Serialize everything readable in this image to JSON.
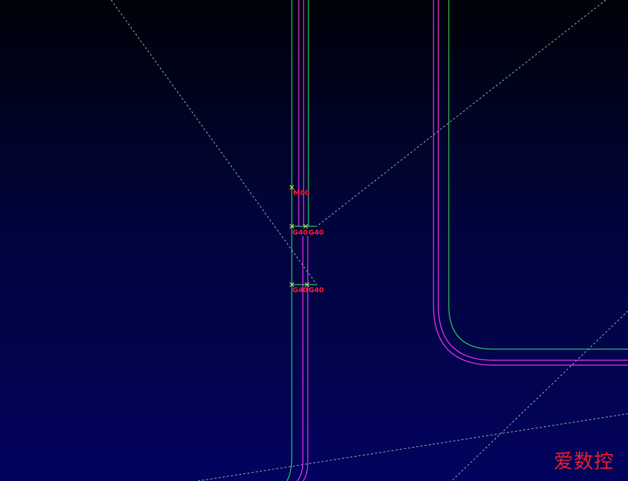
{
  "canvas": {
    "background_top": "#000208",
    "background_bottom": "#02035e"
  },
  "colors": {
    "part_contour": "#33ff66",
    "tool_path": "#ff33ff",
    "guide_lines": "#a8e8b8",
    "marker": "#e8e84a",
    "label_text": "#ff1a3a",
    "watermark": "#e8202a"
  },
  "labels": {
    "start_marker": "M00",
    "lead_in_upper_left": "G40",
    "lead_in_upper_right": "G40",
    "lead_in_lower_left": "G40",
    "lead_in_lower_right": "G40"
  },
  "watermark": "爱数控"
}
